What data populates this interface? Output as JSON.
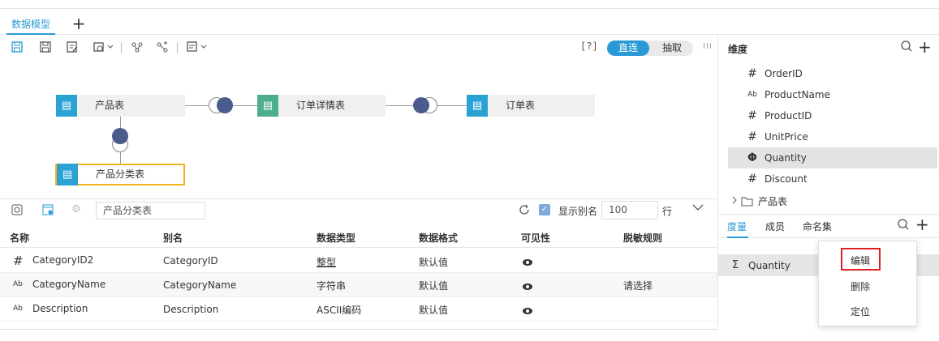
{
  "tabs": {
    "active": "数据模型",
    "add": "+"
  },
  "toolbar": {
    "help": "[?]",
    "mode_direct": "直连",
    "mode_extract": "抽取",
    "more_glyph": "III"
  },
  "diagram": {
    "nodes": {
      "products": "产品表",
      "order_details": "订单详情表",
      "orders": "订单表",
      "product_categories": "产品分类表"
    }
  },
  "field_panel": {
    "search_value": "产品分类表",
    "show_alias_label": "显示别名",
    "rows_value": "100",
    "rows_unit": "行",
    "columns": [
      "名称",
      "别名",
      "数据类型",
      "数据格式",
      "可见性",
      "脱敏规则"
    ],
    "rows": [
      {
        "type_glyph": "#",
        "name": "CategoryID2",
        "alias": "CategoryID",
        "data_type": "整型",
        "format": "默认值",
        "visible": true,
        "mask": ""
      },
      {
        "type_glyph": "Ab",
        "name": "CategoryName",
        "alias": "CategoryName",
        "data_type": "字符串",
        "format": "默认值",
        "visible": true,
        "mask": "请选择"
      },
      {
        "type_glyph": "Ab",
        "name": "Description",
        "alias": "Description",
        "data_type": "ASCII编码",
        "format": "默认值",
        "visible": true,
        "mask": ""
      }
    ]
  },
  "right_panel": {
    "title": "维度",
    "fields": [
      {
        "glyph": "#",
        "name": "OrderID"
      },
      {
        "glyph": "Ab",
        "name": "ProductName"
      },
      {
        "glyph": "#",
        "name": "ProductID"
      },
      {
        "glyph": "#",
        "name": "UnitPrice"
      },
      {
        "glyph": "Φ",
        "name": "Quantity"
      },
      {
        "glyph": "#",
        "name": "Discount"
      }
    ],
    "folder": "产品表",
    "subtabs": [
      "度量",
      "成员",
      "命名集"
    ],
    "measure": {
      "glyph": "Σ",
      "name": "Quantity"
    }
  },
  "context_menu": {
    "items": [
      "编辑",
      "删除",
      "定位"
    ]
  },
  "colors": {
    "accent": "#2a9ad6",
    "highlight": "#e02020",
    "selected_border": "#f2b41c",
    "node_blue": "#2aa3d4",
    "node_green": "#4cae8c",
    "join_dot": "#4a5c8c"
  }
}
